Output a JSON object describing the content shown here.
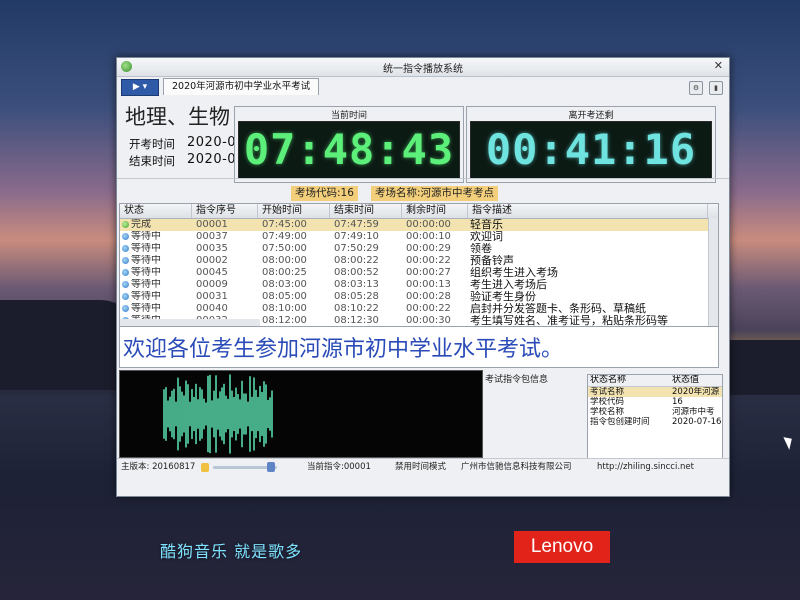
{
  "window": {
    "title": "统一指令播放系统",
    "tab_label": "2020年河源市初中学业水平考试",
    "play_label": "▶ ▾"
  },
  "exam": {
    "subject": "地理、生物",
    "start_label": "开考时间",
    "start_value": "2020-0",
    "end_label": "结束时间",
    "end_value": "2020-0"
  },
  "clocks": {
    "current_caption": "当前时间",
    "current_value": "07:48:43",
    "remaining_caption": "离开考还剩",
    "remaining_value": "00:41:16"
  },
  "room": {
    "code_text": "考场代码:16",
    "name_text": "考场名称:河源市中考考点"
  },
  "table": {
    "headers": [
      "状态",
      "指令序号",
      "开始时间",
      "结束时间",
      "剩余时间",
      "指令描述"
    ],
    "rows": [
      {
        "status": "完成",
        "seq": "00001",
        "start": "07:45:00",
        "end": "07:47:59",
        "remain": "00:00:00",
        "desc": "轻音乐"
      },
      {
        "status": "等待中",
        "seq": "00037",
        "start": "07:49:00",
        "end": "07:49:10",
        "remain": "00:00:10",
        "desc": "欢迎词"
      },
      {
        "status": "等待中",
        "seq": "00035",
        "start": "07:50:00",
        "end": "07:50:29",
        "remain": "00:00:29",
        "desc": "领卷"
      },
      {
        "status": "等待中",
        "seq": "00002",
        "start": "08:00:00",
        "end": "08:00:22",
        "remain": "00:00:22",
        "desc": "预备铃声"
      },
      {
        "status": "等待中",
        "seq": "00045",
        "start": "08:00:25",
        "end": "08:00:52",
        "remain": "00:00:27",
        "desc": "组织考生进入考场"
      },
      {
        "status": "等待中",
        "seq": "00009",
        "start": "08:03:00",
        "end": "08:03:13",
        "remain": "00:00:13",
        "desc": "考生进入考场后"
      },
      {
        "status": "等待中",
        "seq": "00031",
        "start": "08:05:00",
        "end": "08:05:28",
        "remain": "00:00:28",
        "desc": "验证考生身份"
      },
      {
        "status": "等待中",
        "seq": "00040",
        "start": "08:10:00",
        "end": "08:10:22",
        "remain": "00:00:22",
        "desc": "启封并分发答题卡、条形码、草稿纸"
      },
      {
        "status": "等待中",
        "seq": "00032",
        "start": "08:12:00",
        "end": "08:12:30",
        "remain": "00:00:30",
        "desc": "考生填写姓名、准考证号，粘贴条形码等"
      }
    ]
  },
  "banner": {
    "text": "欢迎各位考生参加河源市初中学业水平考试。"
  },
  "info_panel": {
    "title": "考试指令包信息",
    "col_name": "状态名称",
    "col_value": "状态值",
    "rows": [
      {
        "name": "考试名称",
        "value": "2020年河源"
      },
      {
        "name": "学校代码",
        "value": "16"
      },
      {
        "name": "学校名称",
        "value": "河源市中考"
      },
      {
        "name": "指令包创建时间",
        "value": "2020-07-16"
      }
    ]
  },
  "statusbar": {
    "version": "主版本: 20160817",
    "current_cmd": "当前指令:00001",
    "mode": "禁用时间模式",
    "company": "广州市信驰信息科技有限公司",
    "url": "http://zhiling.sincci.net"
  },
  "desktop": {
    "kugou_slogan": "酷狗音乐  就是歌多",
    "lenovo_logo": "Lenovo"
  },
  "colors": {
    "clock_current": "#5cf07a",
    "clock_remaining": "#6fe3e0",
    "info_bar": "#f3cf7b",
    "banner_text": "#2a4bb8",
    "waveform": "#57d7a8"
  }
}
